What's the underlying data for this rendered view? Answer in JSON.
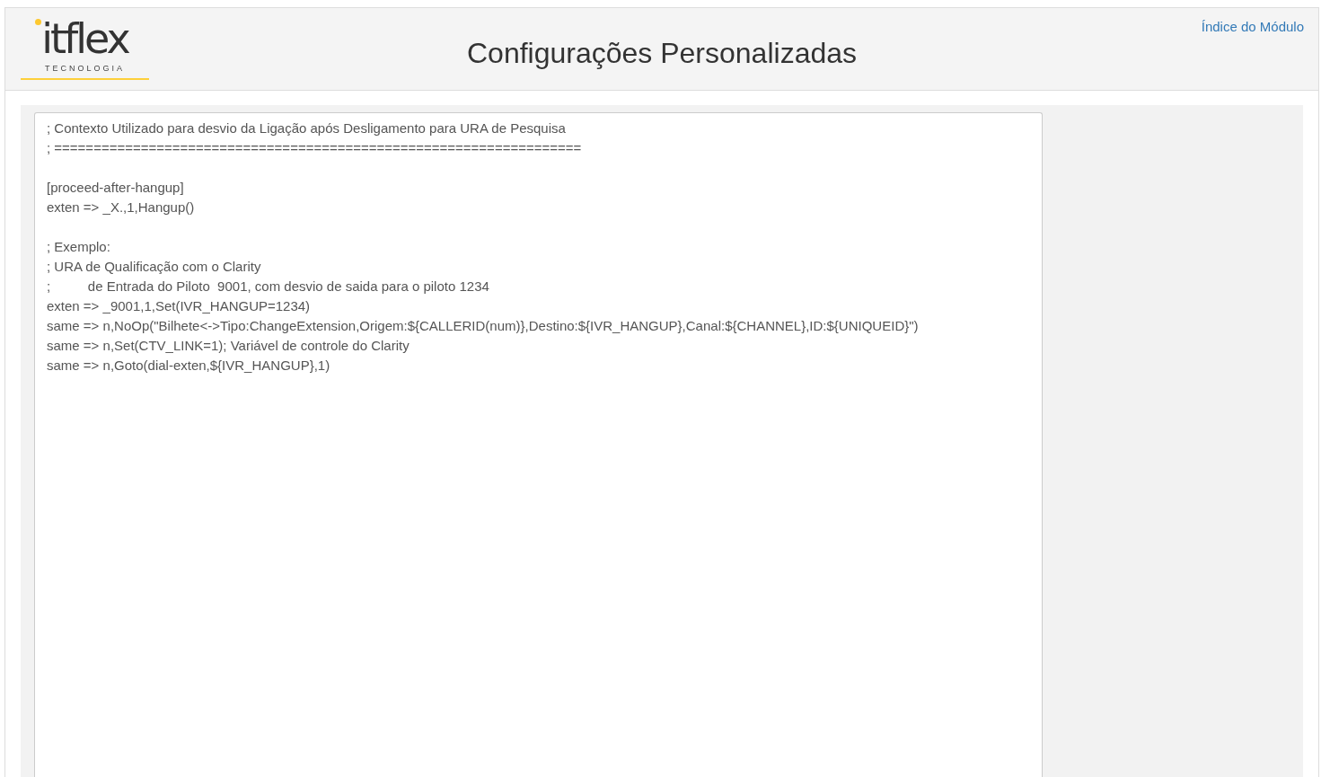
{
  "logo": {
    "wordmark": "itflex",
    "tagline": "TECNOLOGIA"
  },
  "header": {
    "title": "Configurações Personalizadas",
    "link": "Índice do Módulo"
  },
  "editor": {
    "value": "; Contexto Utilizado para desvio da Ligação após Desligamento para URA de Pesquisa\n; ===================================================================\n\n[proceed-after-hangup]\nexten => _X.,1,Hangup()\n\n; Exemplo:\n; URA de Qualificação com o Clarity\n;          de Entrada do Piloto  9001, com desvio de saida para o piloto 1234\nexten => _9001,1,Set(IVR_HANGUP=1234)\nsame => n,NoOp(\"Bilhete<->Tipo:ChangeExtension,Origem:${CALLERID(num)},Destino:${IVR_HANGUP},Canal:${CHANNEL},ID:${UNIQUEID}\")\nsame => n,Set(CTV_LINK=1); Variável de controle do Clarity\nsame => n,Goto(dial-exten,${IVR_HANGUP},1)"
  }
}
